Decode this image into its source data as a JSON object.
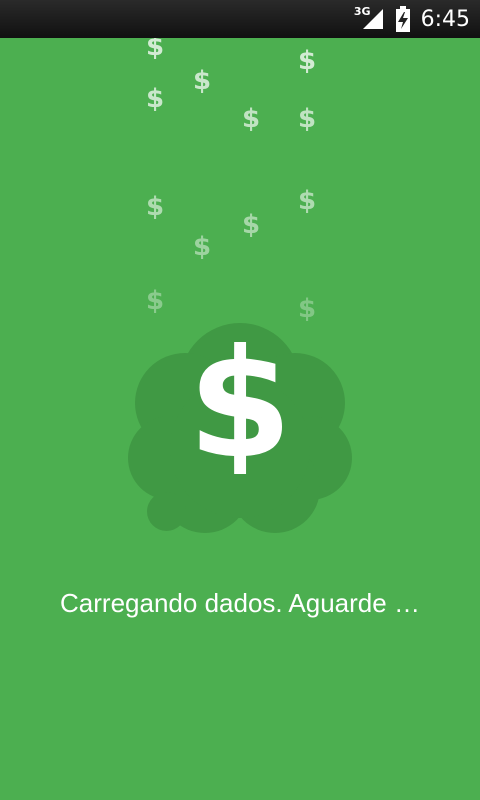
{
  "statusbar": {
    "network": "3G",
    "time": "6:45",
    "icons": [
      "signal-icon",
      "battery-icon"
    ]
  },
  "loading": {
    "message": "Carregando dados. Aguarde …"
  },
  "colors": {
    "background": "#4caf50",
    "cloud": "#409944",
    "statusbar": "#111111",
    "text": "#ffffff"
  }
}
